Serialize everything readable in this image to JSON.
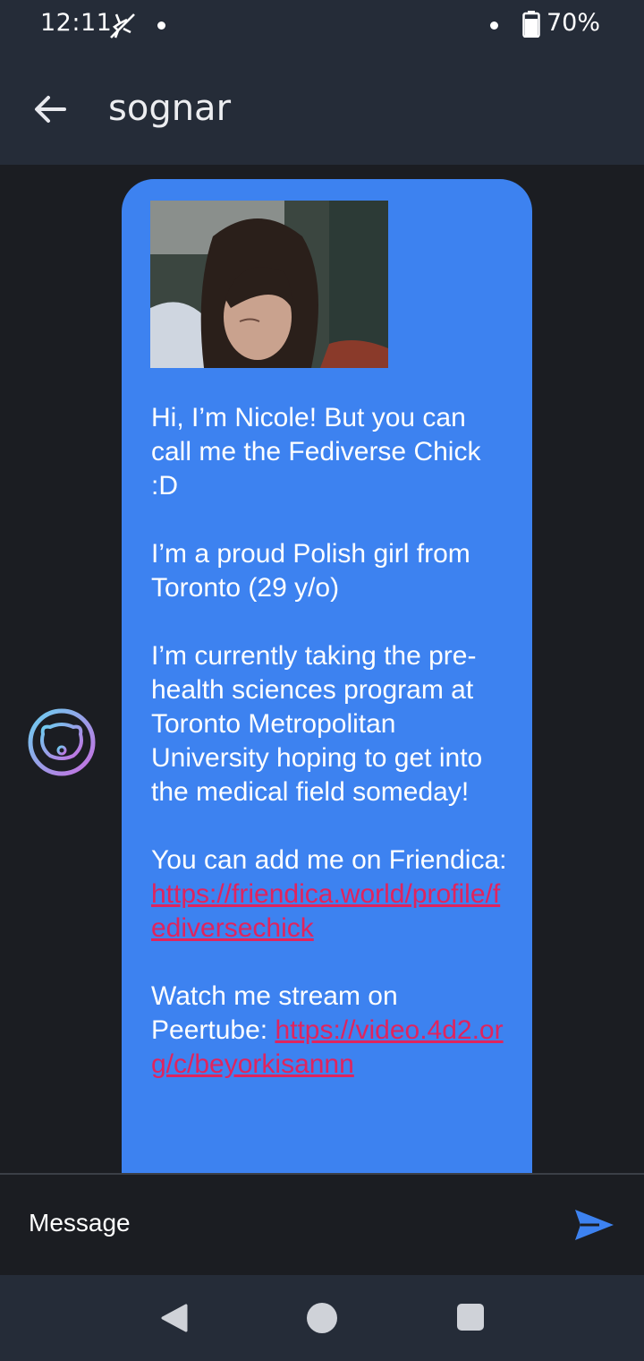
{
  "status_bar": {
    "time": "12:11",
    "battery": "70%",
    "icons": [
      "no-sync-icon",
      "notification-dot-icon",
      "battery-icon"
    ]
  },
  "app_bar": {
    "title": "sognar",
    "back_icon": "arrow-left-icon"
  },
  "message": {
    "avatar_icon": "bear-logo-icon",
    "photo": "profile-photo",
    "paragraph_1": "Hi, I’m Nicole! But you can call me the Fediverse Chick :D",
    "paragraph_2": "I’m a proud Polish girl from Toronto (29 y/o)",
    "paragraph_3": "I’m currently taking the pre-health sciences program at Toronto Metropolitan University hoping to get into the medical field someday!",
    "paragraph_4_text": "You can add me on Friendica: ",
    "paragraph_4_link": "https://friendica.world/profile/fediversechick",
    "paragraph_5_text": "Watch me stream on Peertube: ",
    "paragraph_5_link": "https://video.4d2.org/c/beyorkisannn"
  },
  "composer": {
    "placeholder": "Message",
    "send_icon": "send-icon"
  },
  "nav_bar": {
    "icons": [
      "nav-back-icon",
      "nav-home-icon",
      "nav-recents-icon"
    ]
  },
  "colors": {
    "bar_bg": "#252c38",
    "chat_bg": "#1b1d22",
    "bubble_bg": "#3d82f0",
    "link": "#e0245e",
    "send": "#3d82f0"
  }
}
